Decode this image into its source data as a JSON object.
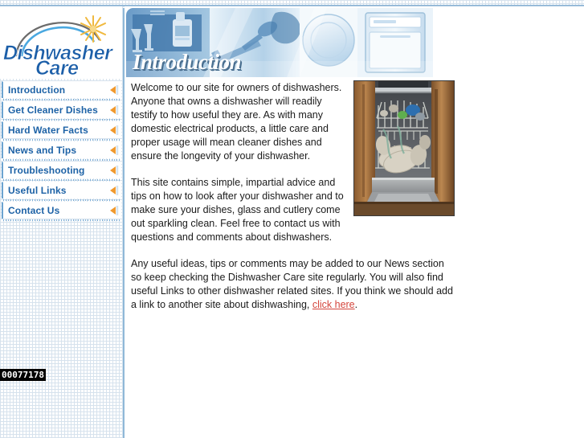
{
  "site": {
    "logo_line1": "Dishwasher",
    "logo_line2": "Care",
    "logo_color": "#1b5ea8",
    "accent_color": "#f0992e"
  },
  "nav": {
    "items": [
      {
        "label": "Introduction",
        "icon": "left-triangle-icon",
        "active": true
      },
      {
        "label": "Get Cleaner Dishes",
        "icon": "left-triangle-icon",
        "active": false
      },
      {
        "label": "Hard Water Facts",
        "icon": "left-triangle-icon",
        "active": false
      },
      {
        "label": "News and Tips",
        "icon": "left-triangle-icon",
        "active": false
      },
      {
        "label": "Troubleshooting",
        "icon": "left-triangle-icon",
        "active": false
      },
      {
        "label": "Useful Links",
        "icon": "left-triangle-icon",
        "active": false
      },
      {
        "label": "Contact Us",
        "icon": "left-triangle-icon",
        "active": false
      }
    ]
  },
  "counter": {
    "value": "00077178"
  },
  "banner": {
    "title": "Introduction",
    "alt": "blue-toned collage of glassware, detergent bottle, cutlery, dinner plate and a dishwasher"
  },
  "article": {
    "paragraph1": "Welcome to our site for owners of dishwashers. Anyone that owns a dishwasher will readily testify to how useful they are. As with many domestic electrical products, a little care and proper usage will mean cleaner dishes and ensure the longevity of your dishwasher.",
    "paragraph2": "This site contains simple, impartial advice and tips on how to look after your dishwasher and to make sure your dishes, glass and cutlery come out sparkling clean. Feel free to contact us with questions and comments about dishwashers.",
    "paragraph3_before_link": "Any useful ideas, tips or comments may be added to our News section so keep checking the Dishwasher Care site regularly. You will also find useful Links to other dishwasher related sites. If you think we should add a link to another site about dishwashing, ",
    "link_text": "click here",
    "paragraph3_after_link": ".",
    "link_color": "#d4453c"
  },
  "photo": {
    "alt": "open dishwasher loaded with plates, bowls and cups inside wooden kitchen cabinetry"
  }
}
